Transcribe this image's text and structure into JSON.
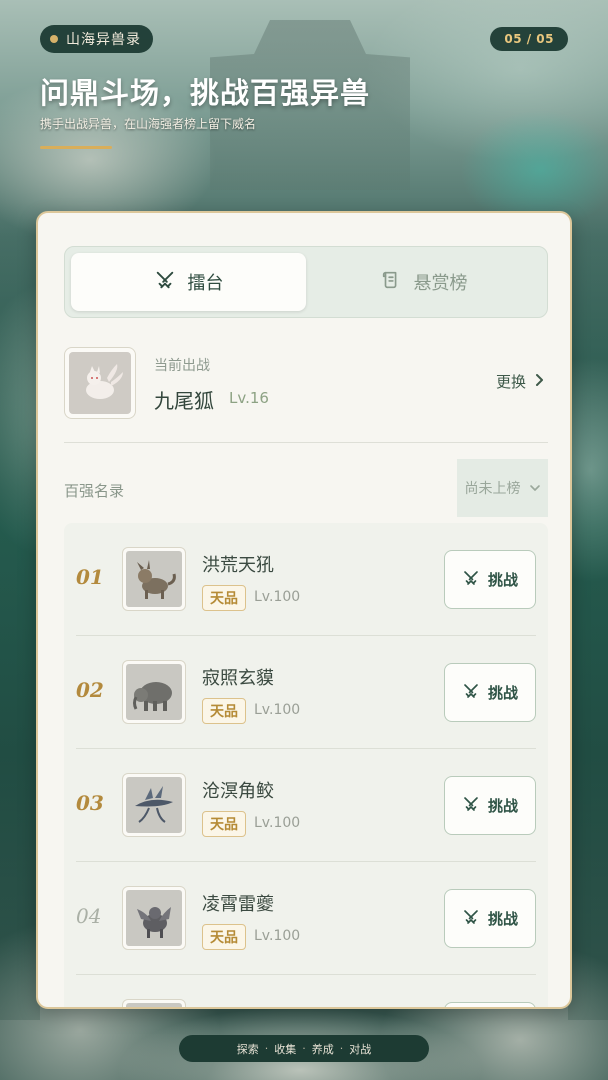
{
  "header": {
    "app_name": "山海异兽录",
    "page_indicator": "05 / 05",
    "title": "问鼎斗场，挑战百强异兽",
    "subtitle": "携手出战异兽，在山海强者榜上留下威名"
  },
  "tabs": [
    {
      "label": "擂台",
      "icon": "crossed-swords-icon",
      "active": true
    },
    {
      "label": "悬赏榜",
      "icon": "scroll-icon",
      "active": false
    }
  ],
  "current_pet": {
    "label": "当前出战",
    "name": "九尾狐",
    "level": "Lv.16",
    "change_label": "更换"
  },
  "ranking": {
    "title": "百强名录",
    "filter_label": "尚未上榜",
    "rows": [
      {
        "rank": "01",
        "name": "洪荒天犼",
        "grade": "天品",
        "level": "Lv.100",
        "action": "挑战"
      },
      {
        "rank": "02",
        "name": "寂照玄貘",
        "grade": "天品",
        "level": "Lv.100",
        "action": "挑战"
      },
      {
        "rank": "03",
        "name": "沧溟角鲛",
        "grade": "天品",
        "level": "Lv.100",
        "action": "挑战"
      },
      {
        "rank": "04",
        "name": "凌霄雷夔",
        "grade": "天品",
        "level": "Lv.100",
        "action": "挑战"
      }
    ]
  },
  "footer_nav": [
    "探索",
    "收集",
    "养成",
    "对战"
  ],
  "colors": {
    "accent_gold": "#d9ae5a",
    "primary_green": "#2f5446",
    "card_bg": "#f7f6f1"
  }
}
